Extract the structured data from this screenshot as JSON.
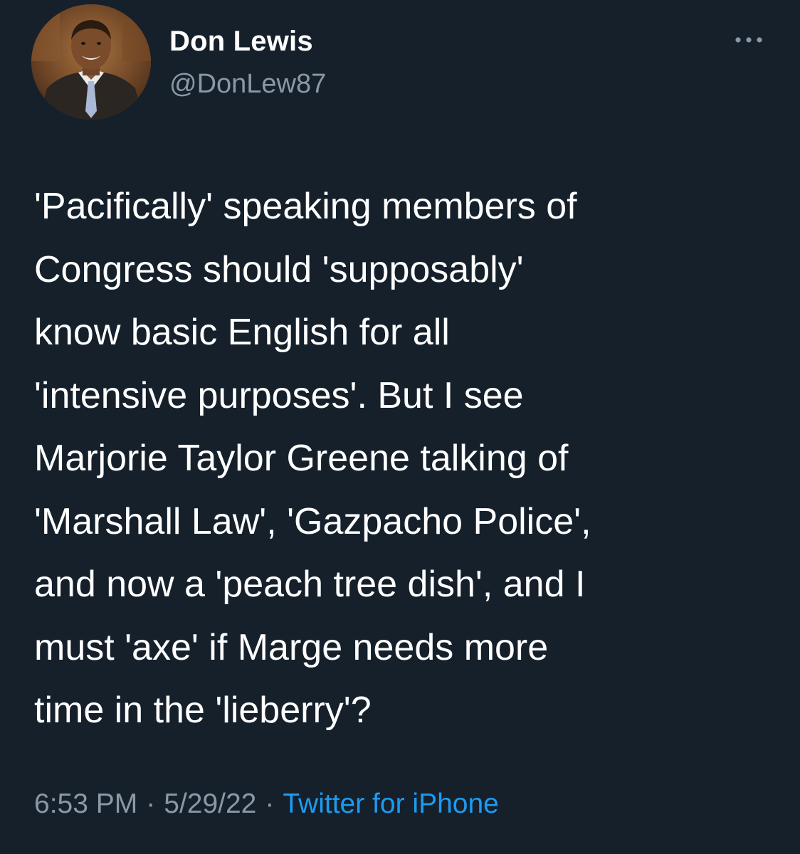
{
  "author": {
    "display_name": "Don Lewis",
    "handle": "@DonLew87"
  },
  "more_icon": "more-horizontal-icon",
  "tweet": {
    "lines": [
      "'Pacifically' speaking members of",
      "Congress should 'supposably'",
      "know basic English for all",
      "'intensive purposes'. But I see",
      "Marjorie Taylor Greene talking of",
      "'Marshall Law', 'Gazpacho Police',",
      "and now a 'peach tree dish', and I",
      "must 'axe' if Marge needs more",
      "time in the 'lieberry'?"
    ]
  },
  "meta": {
    "time": "6:53 PM",
    "separator": "·",
    "date": "5/29/22",
    "source": "Twitter for iPhone"
  },
  "colors": {
    "background": "#15202b",
    "text": "#ffffff",
    "secondary_text": "#8b98a5",
    "link": "#1d9bf0"
  }
}
